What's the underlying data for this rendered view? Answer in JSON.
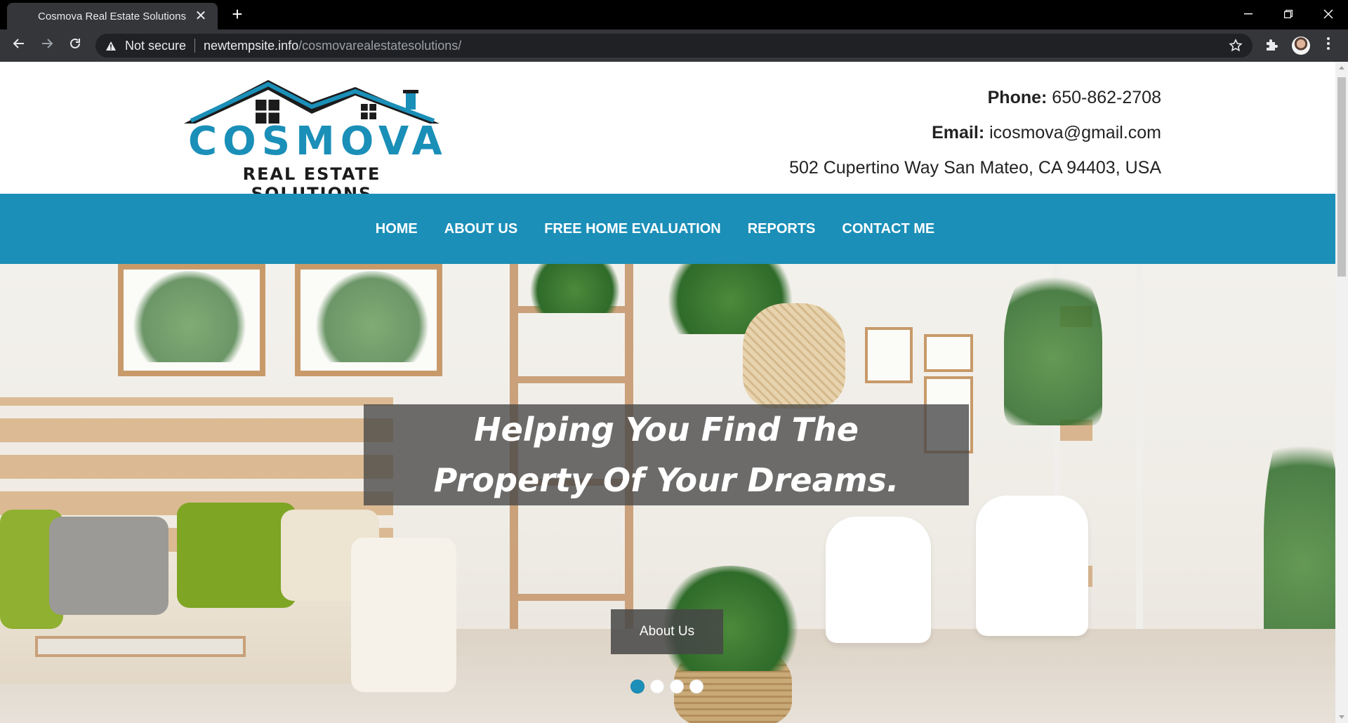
{
  "browser": {
    "tab_title": "Cosmova Real Estate Solutions",
    "tab_close": "✕",
    "new_tab": "+",
    "security_label": "Not secure",
    "url_host": "newtempsite.info",
    "url_path": "/cosmovarealestatesolutions/",
    "icons": {
      "back": "back-arrow-icon",
      "forward": "forward-arrow-icon",
      "reload": "reload-icon",
      "star": "bookmark-star-icon",
      "extensions": "puzzle-icon",
      "menu": "kebab-menu-icon"
    }
  },
  "site": {
    "logo": {
      "word": "COSMOVA",
      "subtitle": "REAL ESTATE SOLUTIONS"
    },
    "contact": {
      "phone_label": "Phone:",
      "phone_value": "650-862-2708",
      "email_label": "Email:",
      "email_value": "icosmova@gmail.com",
      "address": "502 Cupertino Way San Mateo, CA 94403, USA"
    },
    "nav": [
      "HOME",
      "ABOUT US",
      "FREE HOME EVALUATION",
      "REPORTS",
      "CONTACT ME"
    ],
    "hero": {
      "heading": "Helping You Find The Property Of Your Dreams.",
      "button": "About Us",
      "slides_total": 4,
      "active_slide": 1
    },
    "colors": {
      "brand_blue": "#1b8fb8",
      "text_dark": "#222222"
    }
  }
}
